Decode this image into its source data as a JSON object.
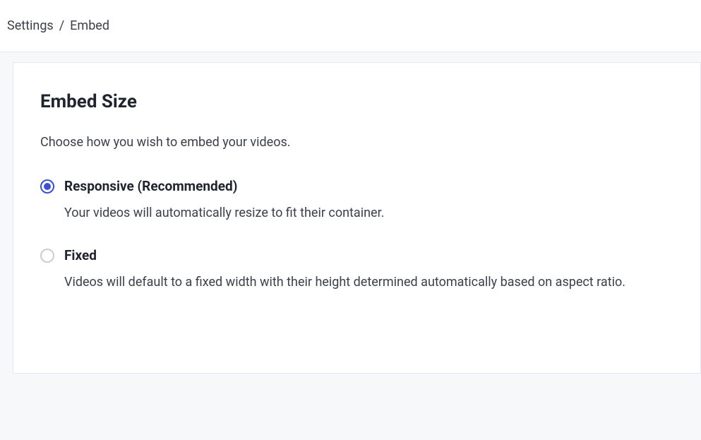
{
  "breadcrumb": {
    "parent": "Settings",
    "separator": "/",
    "current": "Embed"
  },
  "card": {
    "title": "Embed Size",
    "description": "Choose how you wish to embed your videos."
  },
  "options": [
    {
      "label": "Responsive (Recommended)",
      "description": "Your videos will automatically resize to fit their container.",
      "selected": true
    },
    {
      "label": "Fixed",
      "description": "Videos will default to a fixed width with their height determined automatically based on aspect ratio.",
      "selected": false
    }
  ]
}
